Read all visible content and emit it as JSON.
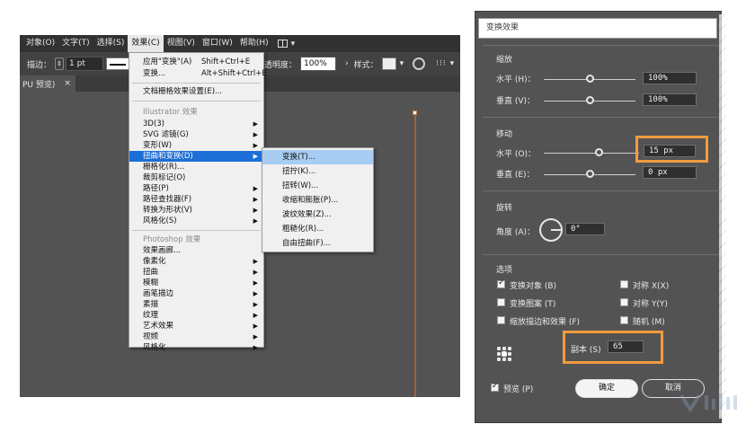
{
  "menubar": {
    "items": [
      "对象(O)",
      "文字(T)",
      "选择(S)",
      "效果(C)",
      "视图(V)",
      "窗口(W)",
      "帮助(H)"
    ],
    "active_index": 3
  },
  "controlbar": {
    "stroke_label": "描边：",
    "stroke_value": "1 pt",
    "opacity_label": "透明度：",
    "opacity_value": "100%",
    "style_label": "样式："
  },
  "tab": {
    "label": "PU 预览)",
    "close": "×"
  },
  "effect_menu": {
    "top_items": [
      {
        "label": "应用\"变换\"(A)",
        "shortcut": "Shift+Ctrl+E"
      },
      {
        "label": "变换...",
        "shortcut": "Alt+Shift+Ctrl+E"
      }
    ],
    "raster_settings": "文档栅格效果设置(E)...",
    "illustrator_header": "Illustrator 效果",
    "illustrator_items": [
      "3D(3)",
      "SVG 滤镜(G)",
      "变形(W)",
      "扭曲和变换(D)",
      "栅格化(R)...",
      "裁剪标记(O)",
      "路径(P)",
      "路径查找器(F)",
      "转换为形状(V)",
      "风格化(S)"
    ],
    "illustrator_highlight_index": 3,
    "photoshop_header": "Photoshop 效果",
    "photoshop_items": [
      "效果画廊...",
      "像素化",
      "扭曲",
      "模糊",
      "画笔描边",
      "素描",
      "纹理",
      "艺术效果",
      "视频",
      "风格化"
    ]
  },
  "distort_menu": {
    "items": [
      "变换(T)...",
      "扭拧(K)...",
      "扭转(W)...",
      "收缩和膨胀(P)...",
      "波纹效果(Z)...",
      "粗糙化(R)...",
      "自由扭曲(F)..."
    ],
    "highlight_index": 0
  },
  "dialog": {
    "title": "变换效果",
    "scale": {
      "title": "缩放",
      "horizontal_label": "水平 (H)：",
      "horizontal_value": "100%",
      "horizontal_level": 0.5,
      "vertical_label": "垂直 (V)：",
      "vertical_value": "100%",
      "vertical_level": 0.5
    },
    "move": {
      "title": "移动",
      "horizontal_label": "水平 (O)：",
      "horizontal_value": "15 px",
      "horizontal_level": 0.58,
      "vertical_label": "垂直 (E)：",
      "vertical_value": "0 px",
      "vertical_level": 0.5
    },
    "rotate": {
      "title": "旋转",
      "angle_label": "角度 (A)：",
      "angle_value": "0°"
    },
    "options": {
      "title": "选项",
      "transform_objects": {
        "label": "变换对象 (B)",
        "checked": true
      },
      "transform_patterns": {
        "label": "变换图案 (T)",
        "checked": false
      },
      "scale_strokes": {
        "label": "缩放描边和效果 (F)",
        "checked": false
      },
      "reflect_x": {
        "label": "对称 X(X)",
        "checked": false
      },
      "reflect_y": {
        "label": "对称 Y(Y)",
        "checked": false
      },
      "random": {
        "label": "随机 (M)",
        "checked": false
      }
    },
    "copies_label": "副本 (S)",
    "copies_value": "65",
    "preview": {
      "label": "预览 (P)",
      "checked": true
    },
    "ok_label": "确定",
    "cancel_label": "取消"
  },
  "colors": {
    "highlight_box": "#f29b3c",
    "menu_highlight": "#1c6fd6",
    "dialog_bg": "#535353"
  }
}
